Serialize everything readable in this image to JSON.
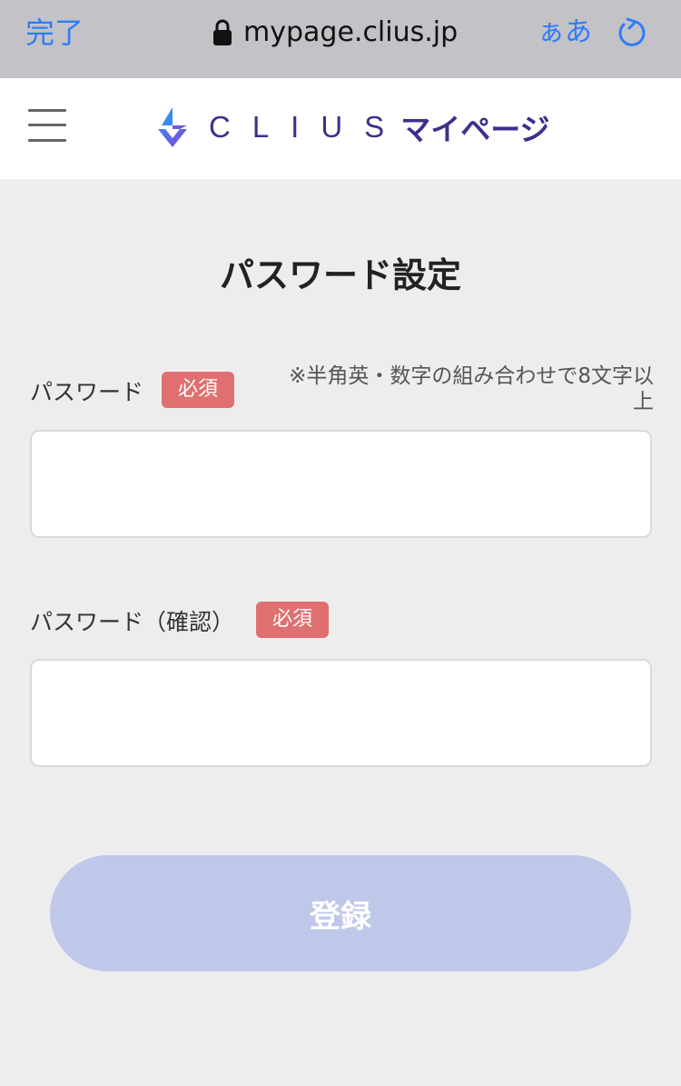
{
  "browser": {
    "done_label": "完了",
    "url": "mypage.clius.jp",
    "text_size_label": "ぁあ"
  },
  "header": {
    "logo_text": "CLIUS",
    "logo_sub": "マイページ"
  },
  "page": {
    "title": "パスワード設定"
  },
  "form": {
    "password": {
      "label": "パスワード",
      "required": "必須",
      "hint_line1": "※半角英・数字の組み合わせで8文字以",
      "hint_line2": "上",
      "value": ""
    },
    "password_confirm": {
      "label": "パスワード（確認）",
      "required": "必須",
      "value": ""
    },
    "submit_label": "登録"
  },
  "colors": {
    "accent": "#2f7cf6",
    "brand": "#3f2f8c",
    "required_badge": "#e07070",
    "submit_disabled": "#bfc8e9"
  },
  "icons": [
    "lock-icon",
    "reload-icon",
    "menu-icon",
    "clius-logo-mark"
  ]
}
